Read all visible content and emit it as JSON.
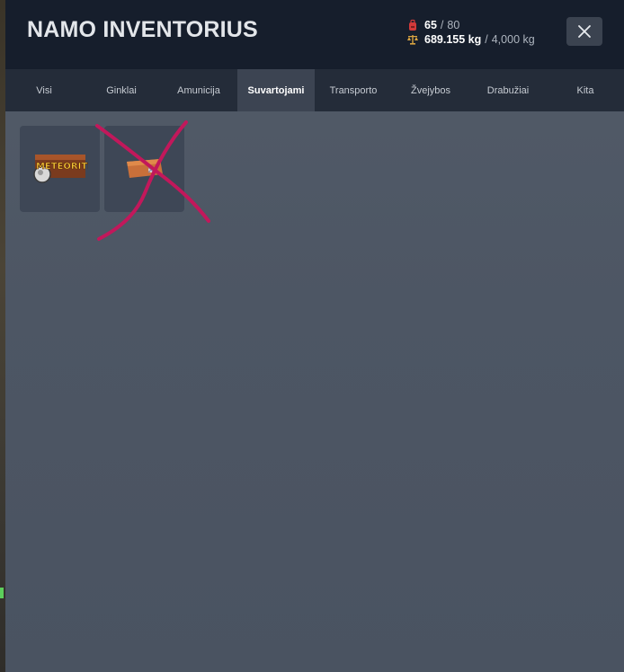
{
  "header": {
    "title": "NAMO INVENTORIUS",
    "slots": {
      "used": "65",
      "separator": "/",
      "max": "80",
      "icon": "backpack-icon"
    },
    "weight": {
      "used": "689.155 kg",
      "separator": "/",
      "max": "4,000 kg",
      "icon": "scale-icon"
    },
    "close_icon": "close-icon"
  },
  "tabs": [
    {
      "label": "Visi",
      "active": false
    },
    {
      "label": "Ginklai",
      "active": false
    },
    {
      "label": "Amunicija",
      "active": false
    },
    {
      "label": "Suvartojami",
      "active": true
    },
    {
      "label": "Transporto",
      "active": false
    },
    {
      "label": "Žvejybos",
      "active": false
    },
    {
      "label": "Drabužiai",
      "active": false
    },
    {
      "label": "Kita",
      "active": false
    }
  ],
  "items": [
    {
      "name": "meteorite",
      "icon_text": "METEORITE"
    },
    {
      "name": "ticket",
      "icon_text": ""
    }
  ],
  "colors": {
    "header_bg": "#161e2c",
    "tabs_bg": "#242c39",
    "active_tab_bg": "#3c4452",
    "slot_bg": "#3e4756",
    "scribble": "#c2185b",
    "slots_icon": "#d23a3a",
    "weight_icon": "#d9a441"
  }
}
